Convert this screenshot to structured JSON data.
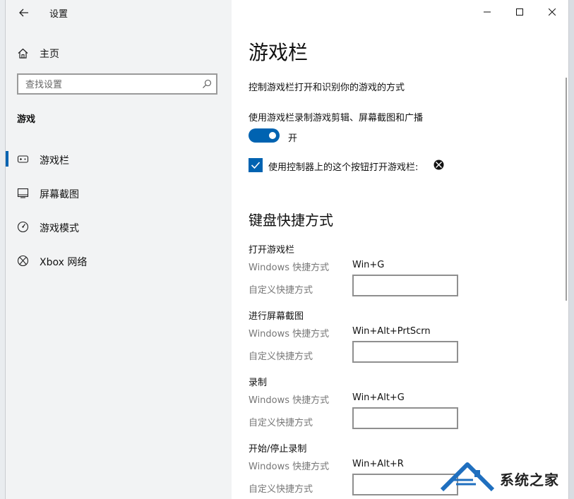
{
  "app": {
    "title": "设置"
  },
  "sidebar": {
    "home_label": "主页",
    "search": {
      "placeholder": "查找设置"
    },
    "section_title": "游戏",
    "items": [
      {
        "label": "游戏栏",
        "icon": "game-bar-icon",
        "selected": true
      },
      {
        "label": "屏幕截图",
        "icon": "capture-icon",
        "selected": false
      },
      {
        "label": "游戏模式",
        "icon": "game-mode-icon",
        "selected": false
      },
      {
        "label": "Xbox 网络",
        "icon": "xbox-icon",
        "selected": false
      }
    ]
  },
  "main": {
    "title": "游戏栏",
    "description": "控制游戏栏打开和识别你的游戏的方式",
    "toggle": {
      "label": "使用游戏栏录制游戏剪辑、屏幕截图和广播",
      "state": "开",
      "on": true
    },
    "checkbox": {
      "label": "使用控制器上的这个按钮打开游戏栏:",
      "checked": true
    },
    "keyboard": {
      "title": "键盘快捷方式",
      "windows_label": "Windows 快捷方式",
      "custom_label": "自定义快捷方式",
      "groups": [
        {
          "title": "打开游戏栏",
          "shortcut": "Win+G"
        },
        {
          "title": "进行屏幕截图",
          "shortcut": "Win+Alt+PrtScrn"
        },
        {
          "title": "录制",
          "shortcut": "Win+Alt+G"
        },
        {
          "title": "开始/停止录制",
          "shortcut": "Win+Alt+R"
        }
      ]
    }
  },
  "watermark": {
    "text": "系统之家"
  },
  "colors": {
    "accent": "#0063b1",
    "sidebar_bg": "#f2f3f4"
  }
}
